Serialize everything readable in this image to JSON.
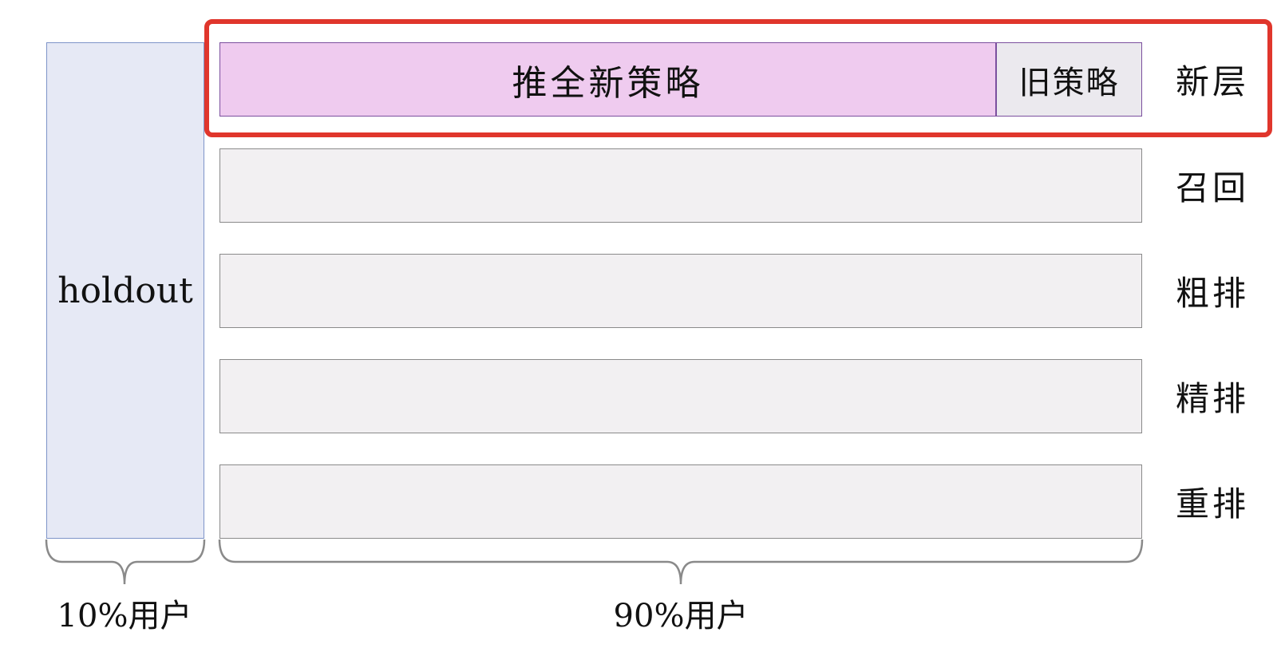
{
  "holdout": {
    "label": "holdout"
  },
  "top_layer": {
    "new_strategy": "推全新策略",
    "old_strategy": "旧策略"
  },
  "layers": [
    {
      "label": "新层"
    },
    {
      "label": "召回"
    },
    {
      "label": "粗排"
    },
    {
      "label": "精排"
    },
    {
      "label": "重排"
    }
  ],
  "bottom": {
    "holdout_users": "10%用户",
    "experiment_users": "90%用户"
  },
  "colors": {
    "holdout_fill": "#e6e9f5",
    "new_strategy_fill": "#efcbef",
    "old_strategy_fill": "#ebe9ee",
    "layer_fill": "#f2f0f2",
    "highlight": "#e0362c"
  }
}
